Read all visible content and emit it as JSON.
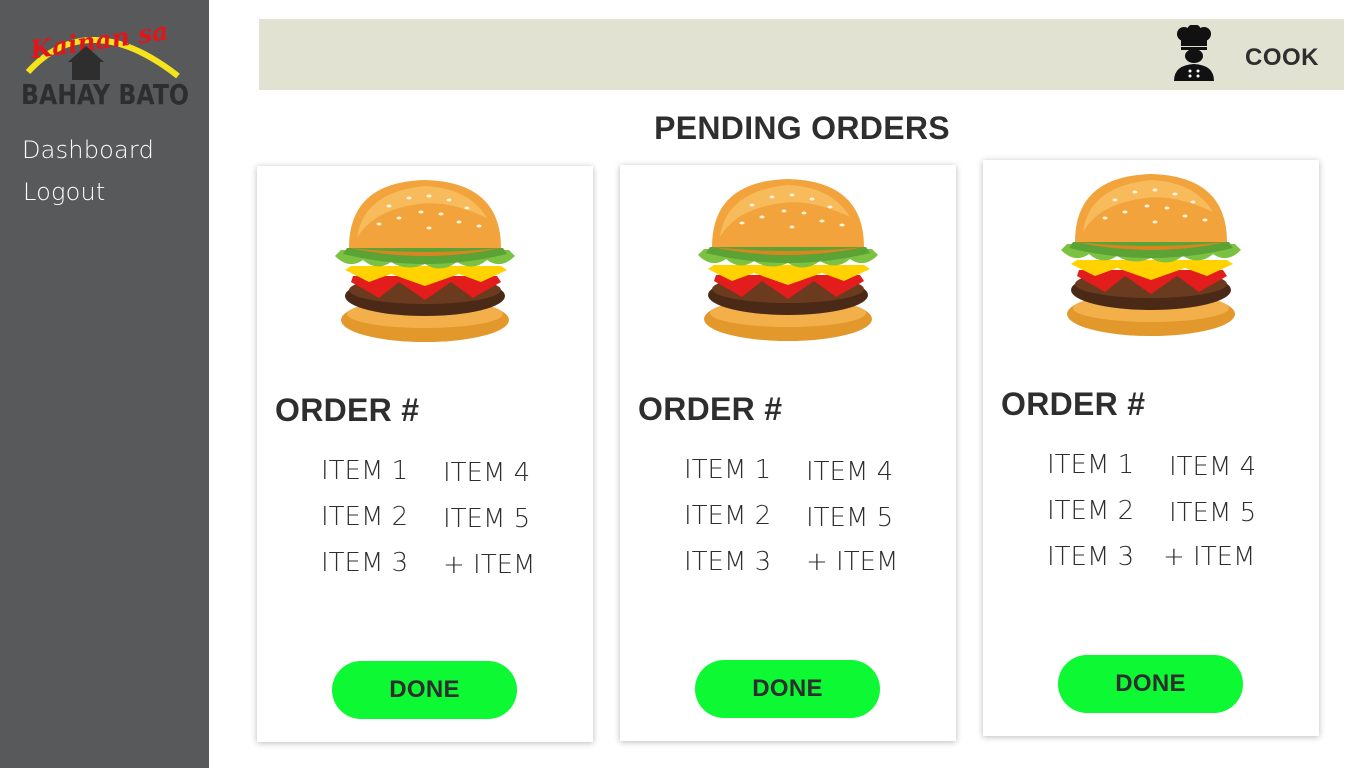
{
  "brand": {
    "logo_script": "Kainan sa",
    "logo_name": "BAHAY BATO"
  },
  "sidebar": {
    "items": [
      {
        "label": "Dashboard"
      },
      {
        "label": "Logout"
      }
    ]
  },
  "header": {
    "role_label": "COOK",
    "icon": "chef-icon"
  },
  "main": {
    "title": "PENDING ORDERS",
    "orders": [
      {
        "title": "ORDER #",
        "items": [
          "ITEM 1",
          "ITEM 2",
          "ITEM 3",
          "ITEM 4",
          "ITEM 5",
          "+ ITEM"
        ],
        "done_label": "DONE"
      },
      {
        "title": "ORDER #",
        "items": [
          "ITEM 1",
          "ITEM 2",
          "ITEM 3",
          "ITEM 4",
          "ITEM 5",
          "+ ITEM"
        ],
        "done_label": "DONE"
      },
      {
        "title": "ORDER #",
        "items": [
          "ITEM 1",
          "ITEM 2",
          "ITEM 3",
          "ITEM 4",
          "ITEM 5",
          "+ ITEM"
        ],
        "done_label": "DONE"
      }
    ]
  },
  "colors": {
    "sidebar_bg": "#58595b",
    "topbar_bg": "#e1e2d2",
    "done_button": "#0cf933",
    "text": "#2e2e2e"
  }
}
